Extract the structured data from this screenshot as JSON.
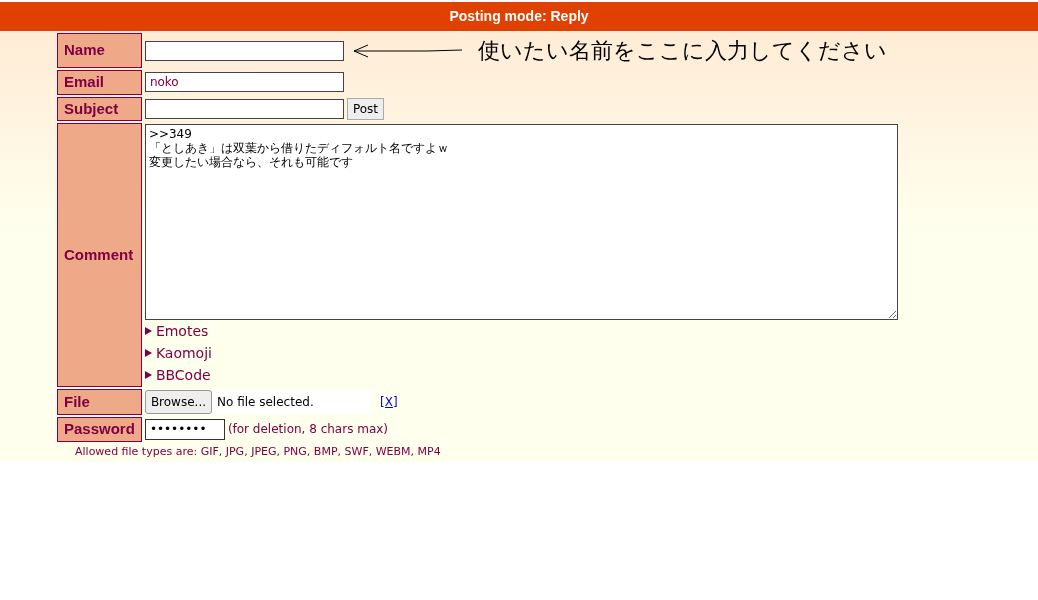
{
  "header": {
    "title": "Posting mode: Reply"
  },
  "annotation": {
    "text": "使いたい名前をここに入力してください"
  },
  "form": {
    "name": {
      "label": "Name"
    },
    "email": {
      "label": "Email",
      "value": "noko"
    },
    "subject": {
      "label": "Subject",
      "submit": "Post"
    },
    "comment": {
      "label": "Comment",
      "lines": [
        ">>349",
        "「としあき」は双葉から借りたディフォルト名ですよｗ",
        "変更したい場合なら、それも可能です"
      ]
    },
    "toggles": [
      {
        "label": "Emotes",
        "expanded": false
      },
      {
        "label": "Kaomoji",
        "expanded": false
      },
      {
        "label": "BBCode",
        "expanded": false
      }
    ],
    "file": {
      "label": "File",
      "button": "Browse...",
      "status": "No file selected.",
      "clear": "[X]"
    },
    "password": {
      "label": "Password",
      "masked": "••••••••",
      "hint": "(for deletion, 8 chars max)"
    },
    "rules": [
      "Allowed file types are: GIF, JPG, JPEG, PNG, BMP, SWF, WEBM, MP4"
    ]
  }
}
